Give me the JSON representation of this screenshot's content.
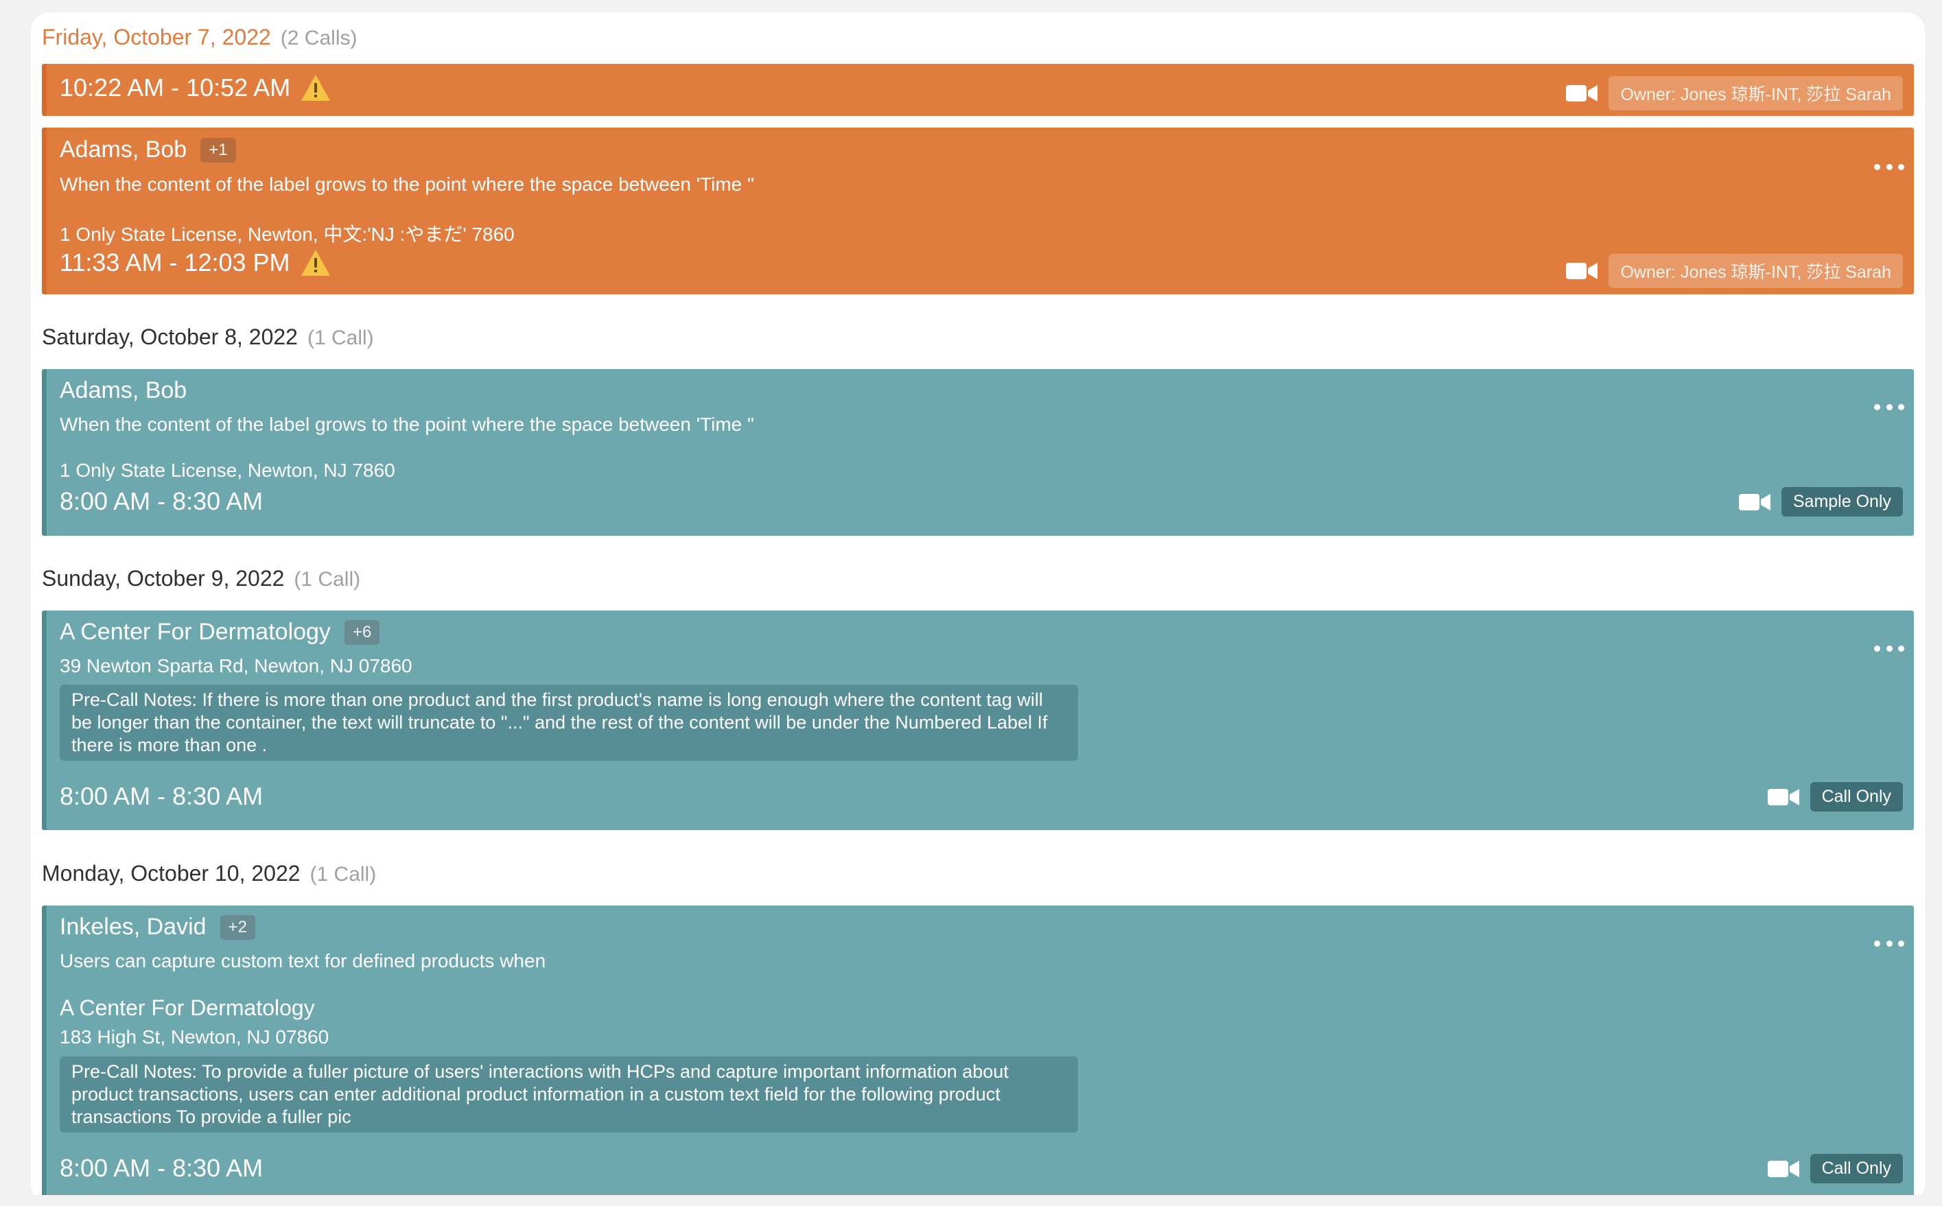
{
  "days": [
    {
      "date": "Friday, October 7, 2022",
      "count": "(2 Calls)"
    },
    {
      "date": "Saturday, October 8, 2022",
      "count": "(1 Call)"
    },
    {
      "date": "Sunday, October 9, 2022",
      "count": "(1 Call)"
    },
    {
      "date": "Monday, October 10, 2022",
      "count": "(1 Call)"
    }
  ],
  "calls": [
    {
      "time": "10:22 AM - 10:52 AM",
      "warning": true,
      "tag": "Owner: Jones 琼斯-INT, 莎拉 Sarah"
    },
    {
      "name": "Adams, Bob",
      "badge": "+1",
      "desc": "When the content of the label grows to the point where the space between 'Time \"",
      "address": "1 Only State License, Newton, 中文:'NJ :やまだ' 7860",
      "time": "11:33 AM - 12:03 PM",
      "warning": true,
      "tag": "Owner: Jones 琼斯-INT, 莎拉 Sarah"
    },
    {
      "name": "Adams, Bob",
      "desc": "When the content of the label grows to the point where the space between 'Time \"",
      "address": "1 Only State License, Newton, NJ 7860",
      "time": "8:00 AM - 8:30 AM",
      "tag": "Sample Only"
    },
    {
      "name": "A Center For Dermatology",
      "badge": "+6",
      "address": "39 Newton Sparta Rd, Newton, NJ 07860",
      "notes": "Pre-Call Notes: If there is more than one product and the first product's name is long enough where the content tag will be longer than the container, the text will truncate to \"...\" and the rest of the content will be under the Numbered Label If there is more than one .",
      "time": "8:00 AM - 8:30 AM",
      "tag": "Call Only"
    },
    {
      "name": "Inkeles, David",
      "badge": "+2",
      "desc": "Users can capture custom text for defined products when",
      "subname": "A Center For Dermatology",
      "address": "183 High St, Newton, NJ 07860",
      "notes": "Pre-Call Notes: To provide a fuller picture of users' interactions with HCPs and capture important information about product transactions, users can enter additional product information in a custom text field for the following product transactions To provide a fuller pic",
      "time": "8:00 AM - 8:30 AM",
      "tag": "Call Only"
    }
  ],
  "colors": {
    "orange": "#e07d3e",
    "teal": "#6da8af",
    "date_warning": "#de7b3d"
  },
  "icons": [
    "warning-icon",
    "video-icon",
    "more-icon"
  ]
}
